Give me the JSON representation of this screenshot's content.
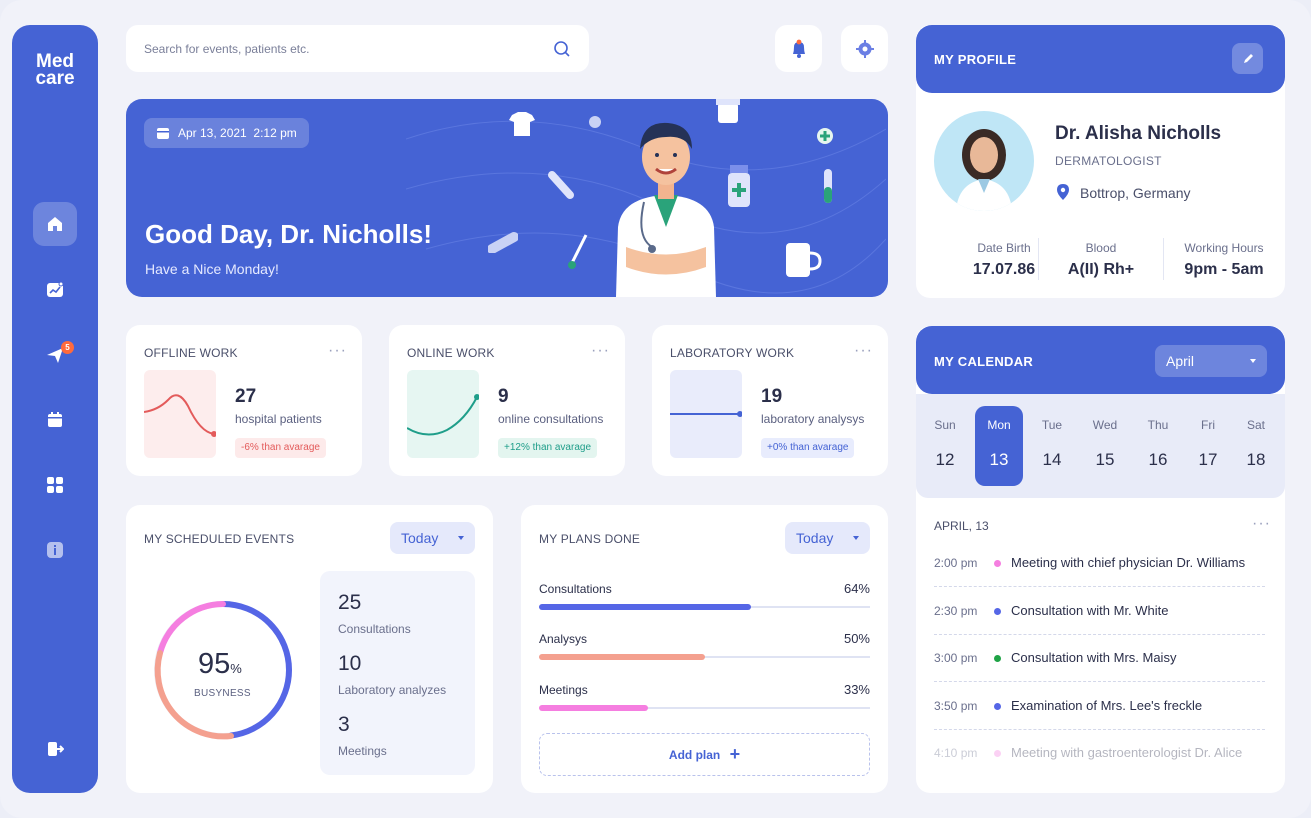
{
  "app": {
    "logo_line1": "Med",
    "logo_line2": "care"
  },
  "sidebar": {
    "items": [
      {
        "icon": "home-icon"
      },
      {
        "icon": "analytics-icon"
      },
      {
        "icon": "send-icon",
        "badge": "5"
      },
      {
        "icon": "calendar-icon"
      },
      {
        "icon": "grid-icon"
      },
      {
        "icon": "info-icon"
      }
    ],
    "logout_icon": "logout-icon"
  },
  "search": {
    "placeholder": "Search for events, patients etc."
  },
  "hero": {
    "date": "Apr 13, 2021",
    "time": "2:12 pm",
    "greeting": "Good Day, Dr. Nicholls!",
    "subtitle": "Have a Nice Monday!"
  },
  "stats": [
    {
      "title": "OFFLINE WORK",
      "value": "27",
      "label": "hospital patients",
      "delta": "-6% than avarage",
      "color": "#e35b5b"
    },
    {
      "title": "ONLINE WORK",
      "value": "9",
      "label": "online consultations",
      "delta": "+12% than avarage",
      "color": "#1f9e8a"
    },
    {
      "title": "LABORATORY WORK",
      "value": "19",
      "label": "laboratory analysys",
      "delta": "+0% than avarage",
      "color": "#4563d4"
    }
  ],
  "scheduled": {
    "title": "MY SCHEDULED EVENTS",
    "filter": "Today",
    "busyness_value": "95",
    "busyness_unit": "%",
    "busyness_label": "BUSYNESS",
    "items": [
      {
        "value": "25",
        "label": "Consultations"
      },
      {
        "value": "10",
        "label": "Laboratory analyzes"
      },
      {
        "value": "3",
        "label": "Meetings"
      }
    ]
  },
  "plans": {
    "title": "MY PLANS DONE",
    "filter": "Today",
    "items": [
      {
        "label": "Consultations",
        "percent": "64%",
        "fraction": 0.64,
        "color": "#5566e6"
      },
      {
        "label": "Analysys",
        "percent": "50%",
        "fraction": 0.5,
        "color": "#f4a08f"
      },
      {
        "label": "Meetings",
        "percent": "33%",
        "fraction": 0.33,
        "color": "#f57ee0"
      }
    ],
    "add_label": "Add plan",
    "add_icon": "plus-icon"
  },
  "profile": {
    "title": "MY PROFILE",
    "name": "Dr. Alisha Nicholls",
    "role": "DERMATOLOGIST",
    "location": "Bottrop, Germany",
    "meta": [
      {
        "label": "Date Birth",
        "value": "17.07.86"
      },
      {
        "label": "Blood",
        "value": "A(II) Rh+"
      },
      {
        "label": "Working Hours",
        "value": "9pm - 5am"
      }
    ]
  },
  "calendar": {
    "title": "MY CALENDAR",
    "month": "April",
    "days": [
      {
        "name": "Sun",
        "date": "12"
      },
      {
        "name": "Mon",
        "date": "13",
        "selected": true
      },
      {
        "name": "Tue",
        "date": "14"
      },
      {
        "name": "Wed",
        "date": "15"
      },
      {
        "name": "Thu",
        "date": "16"
      },
      {
        "name": "Fri",
        "date": "17"
      },
      {
        "name": "Sat",
        "date": "18"
      }
    ],
    "date_heading": "APRIL, 13",
    "events": [
      {
        "time": "2:00 pm",
        "text": "Meeting with chief physician Dr. Williams",
        "color": "#f57ee0"
      },
      {
        "time": "2:30 pm",
        "text": "Consultation with Mr. White",
        "color": "#5566e6"
      },
      {
        "time": "3:00 pm",
        "text": "Consultation with Mrs. Maisy",
        "color": "#1fa346"
      },
      {
        "time": "3:50 pm",
        "text": "Examination of Mrs. Lee's freckle",
        "color": "#5566e6"
      },
      {
        "time": "4:10 pm",
        "text": "Meeting with gastroenterologist Dr. Alice",
        "color": "#f57ee0"
      }
    ]
  }
}
